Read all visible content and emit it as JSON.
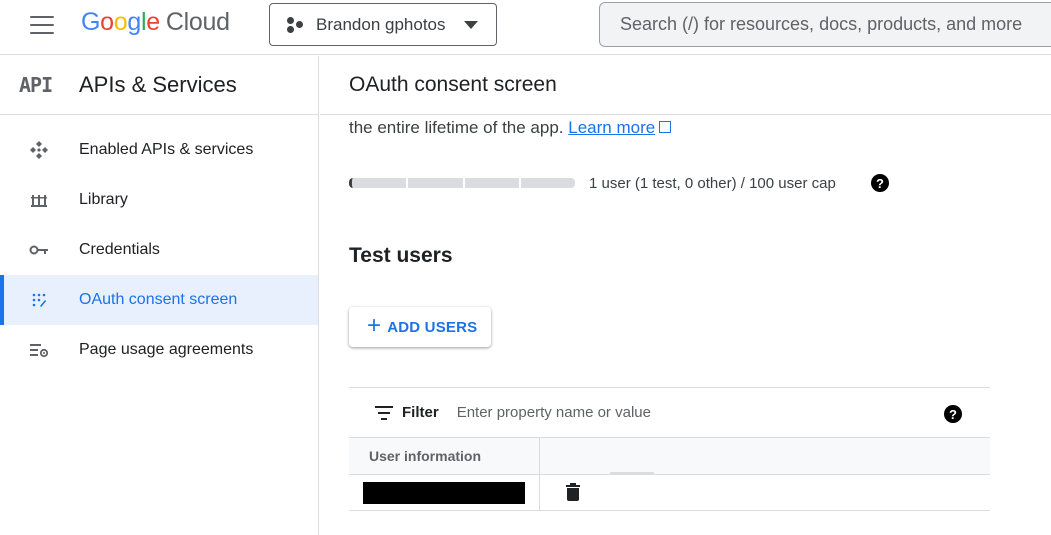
{
  "topbar": {
    "logo_google": "Google",
    "logo_cloud": "Cloud",
    "project_name": "Brandon gphotos",
    "search_placeholder": "Search (/) for resources, docs, products, and more"
  },
  "sidebar": {
    "badge": "API",
    "title": "APIs & Services",
    "items": [
      {
        "label": "Enabled APIs & services",
        "icon": "enabled-apis-icon"
      },
      {
        "label": "Library",
        "icon": "library-icon"
      },
      {
        "label": "Credentials",
        "icon": "key-icon"
      },
      {
        "label": "OAuth consent screen",
        "icon": "oauth-consent-icon",
        "active": true
      },
      {
        "label": "Page usage agreements",
        "icon": "page-usage-settings-icon"
      }
    ]
  },
  "main": {
    "title": "OAuth consent screen",
    "lifetime_text": "the entire lifetime of the app.",
    "learn_more": "Learn more",
    "user_cap_text": "1 user (1 test, 0 other) / 100 user cap",
    "user_cap_fraction": 0.01,
    "help_glyph": "?",
    "section_title": "Test users",
    "add_users_label": "ADD USERS",
    "filter_label": "Filter",
    "filter_placeholder": "Enter property name or value",
    "table": {
      "columns": [
        "User information",
        ""
      ],
      "rows": [
        {
          "user": "[redacted]"
        }
      ]
    }
  },
  "colors": {
    "accent": "#1a73e8",
    "active_bg": "#e8f0fe",
    "border": "#dadce0"
  }
}
